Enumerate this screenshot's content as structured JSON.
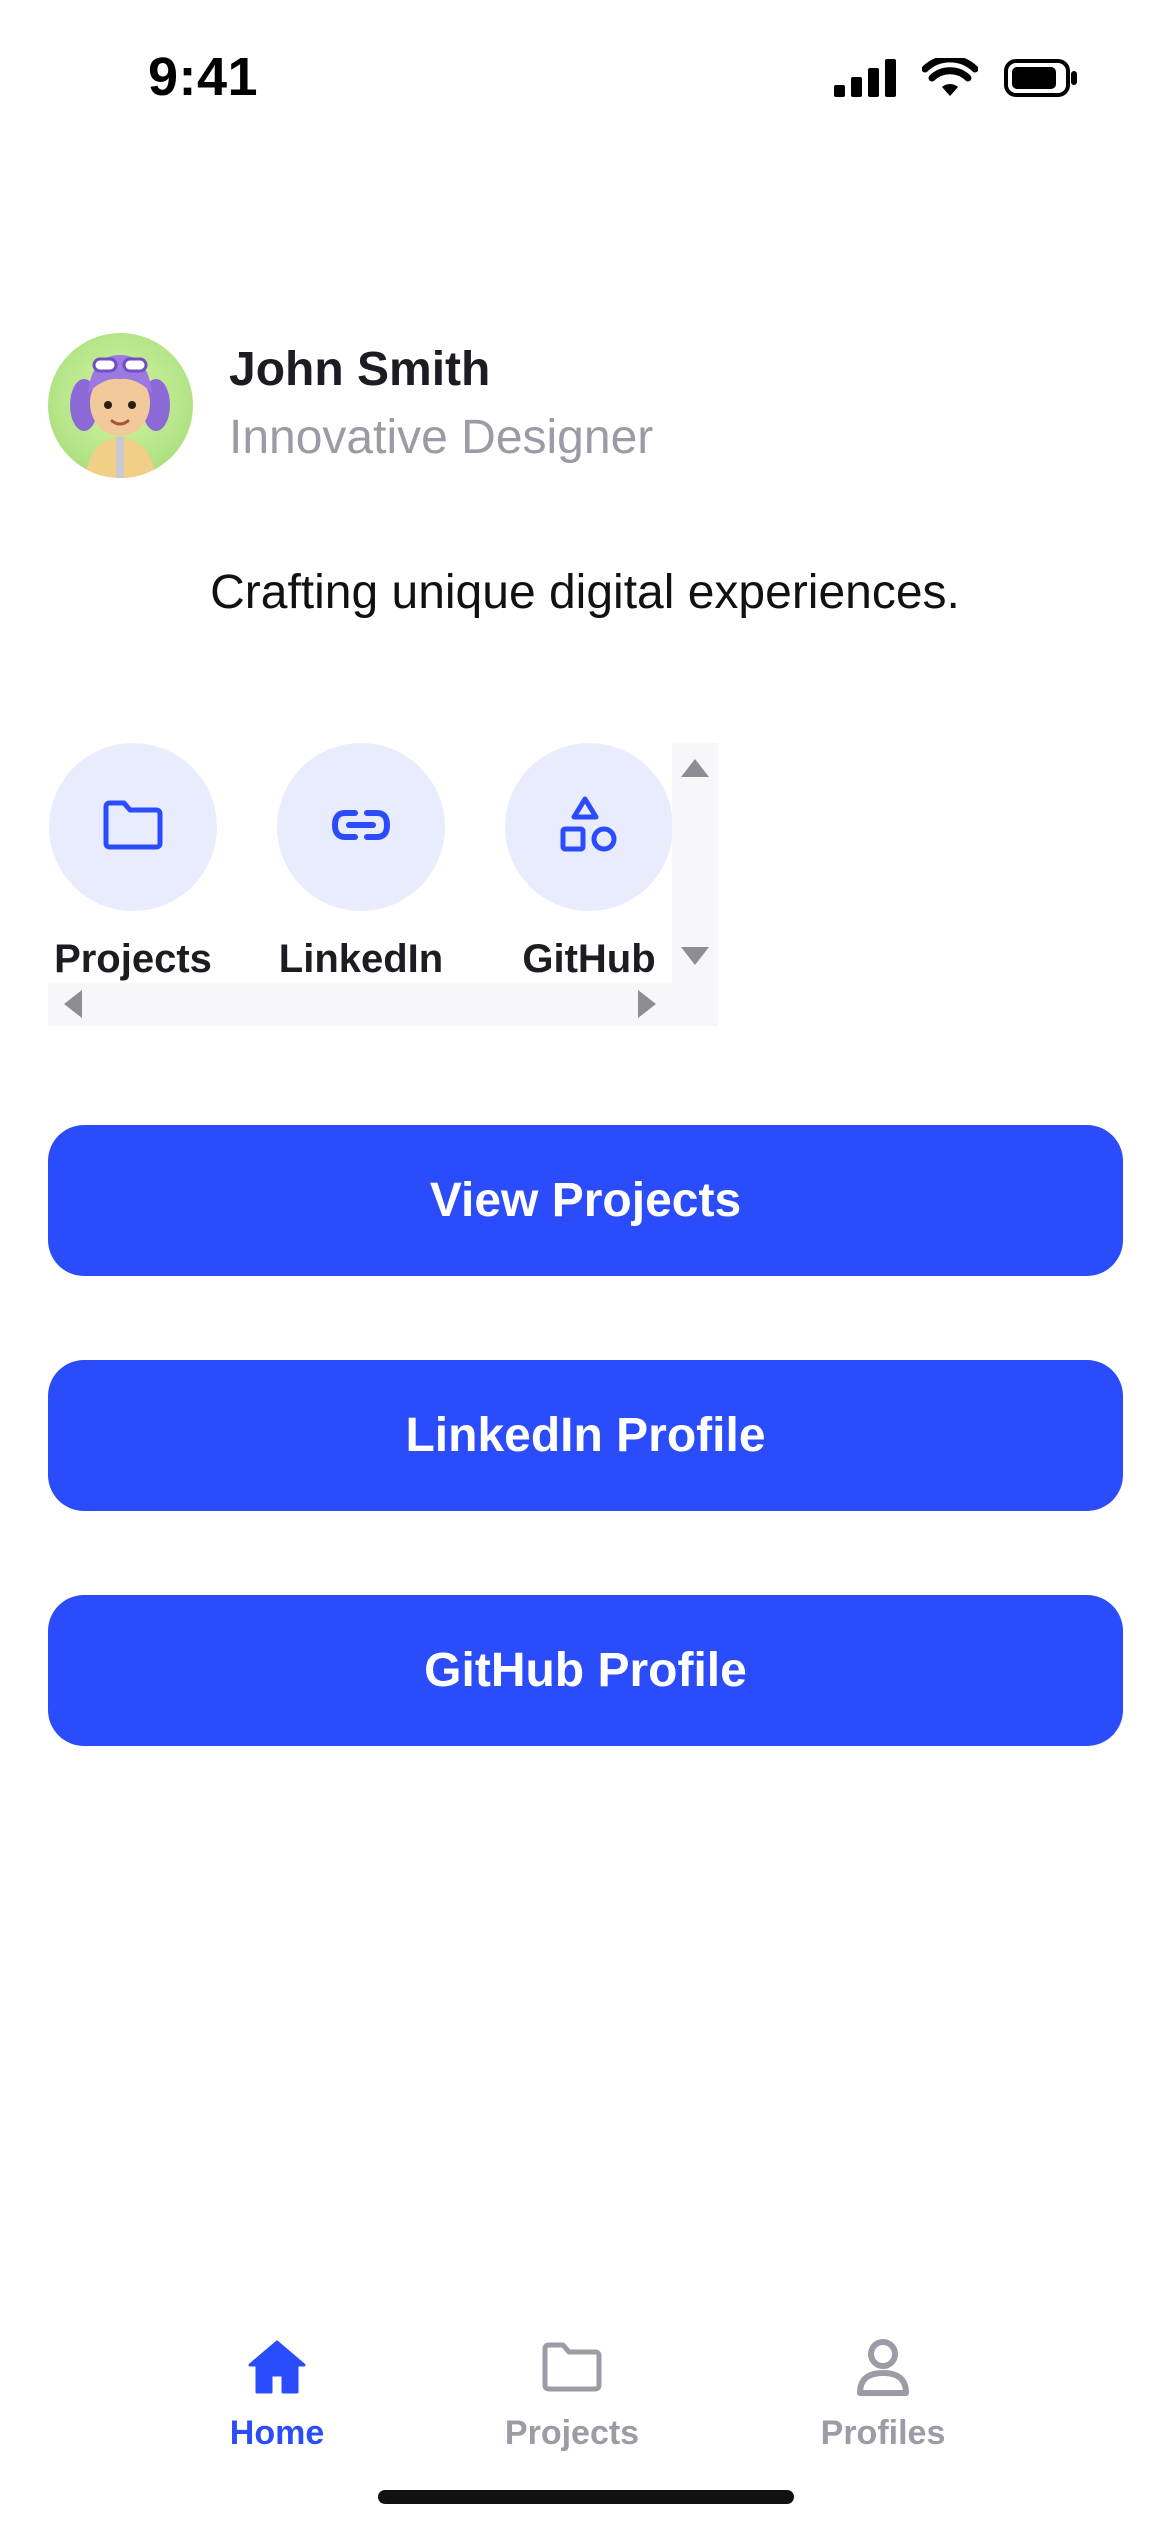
{
  "status_bar": {
    "time": "9:41"
  },
  "profile": {
    "name": "John Smith",
    "title": "Innovative Designer",
    "tagline": "Crafting unique digital experiences."
  },
  "quick_links": [
    {
      "label": "Projects",
      "icon": "folder-icon"
    },
    {
      "label": "LinkedIn",
      "icon": "link-icon"
    },
    {
      "label": "GitHub",
      "icon": "shapes-icon"
    }
  ],
  "buttons": {
    "view_projects": "View Projects",
    "linkedin_profile": "LinkedIn Profile",
    "github_profile": "GitHub Profile"
  },
  "tab_bar": {
    "tabs": [
      {
        "label": "Home",
        "icon": "home-icon",
        "active": true
      },
      {
        "label": "Projects",
        "icon": "folder-icon",
        "active": false
      },
      {
        "label": "Profiles",
        "icon": "person-icon",
        "active": false
      }
    ]
  },
  "colors": {
    "accent": "#2b4cfb",
    "accent_soft": "#e8ecfd",
    "muted_text": "#9b9ba6"
  }
}
